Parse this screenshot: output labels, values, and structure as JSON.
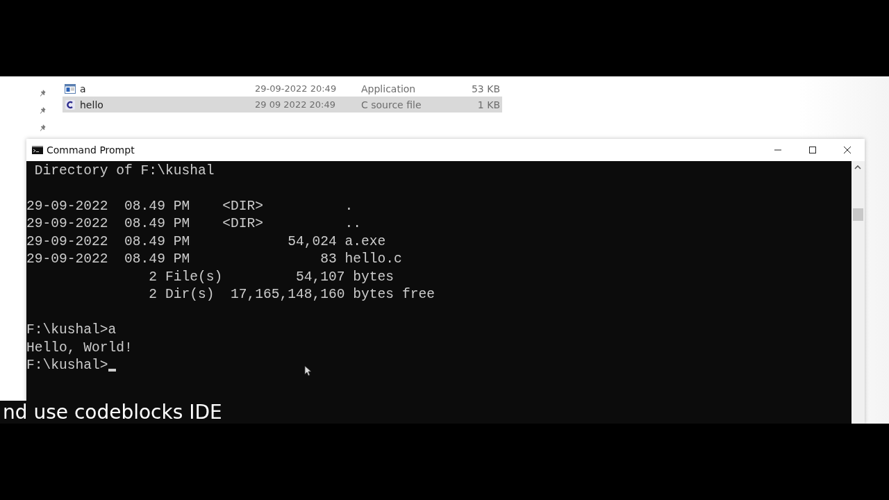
{
  "explorer": {
    "rows": [
      {
        "kind": "application",
        "name": "a",
        "date": "29-09-2022 20:49",
        "type": "Application",
        "size": "53 KB",
        "selected": false
      },
      {
        "kind": "source",
        "name": "hello",
        "date": "29 09 2022 20:49",
        "type": "C source file",
        "size": "1 KB",
        "selected": true
      }
    ]
  },
  "window": {
    "title": "Command Prompt"
  },
  "terminal": {
    "lines": [
      {
        "text": " Directory of F:\\kushal",
        "space_before": false,
        "cursor": false
      },
      {
        "text": "29-09-2022  08.49 PM    <DIR>          .",
        "space_before": true,
        "cursor": false
      },
      {
        "text": "29-09-2022  08.49 PM    <DIR>          ..",
        "space_before": false,
        "cursor": false
      },
      {
        "text": "29-09-2022  08.49 PM            54,024 a.exe",
        "space_before": false,
        "cursor": false
      },
      {
        "text": "29-09-2022  08.49 PM                83 hello.c",
        "space_before": false,
        "cursor": false
      },
      {
        "text": "               2 File(s)         54,107 bytes",
        "space_before": false,
        "cursor": false
      },
      {
        "text": "               2 Dir(s)  17,165,148,160 bytes free",
        "space_before": false,
        "cursor": false
      },
      {
        "text": "F:\\kushal>a",
        "space_before": true,
        "cursor": false
      },
      {
        "text": "Hello, World!",
        "space_before": false,
        "cursor": false
      },
      {
        "text": "F:\\kushal>",
        "space_before": false,
        "cursor": true
      }
    ]
  },
  "caption": "nd use codeblocks IDE"
}
